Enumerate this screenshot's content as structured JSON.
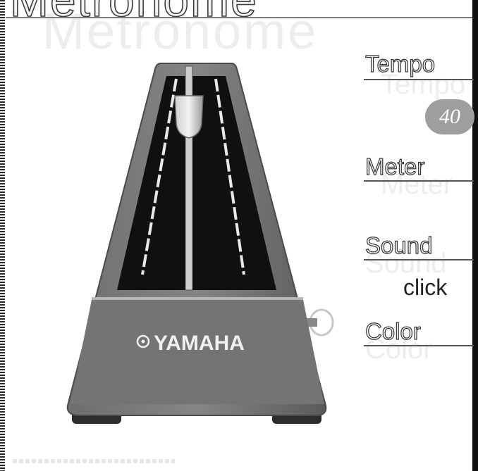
{
  "app": {
    "title": "Metronome"
  },
  "metronome": {
    "brand": "YAMAHA"
  },
  "settings": {
    "tempo": {
      "label": "Tempo",
      "value": "40"
    },
    "meter": {
      "label": "Meter"
    },
    "sound": {
      "label": "Sound",
      "value": "click"
    },
    "color": {
      "label": "Color"
    }
  }
}
